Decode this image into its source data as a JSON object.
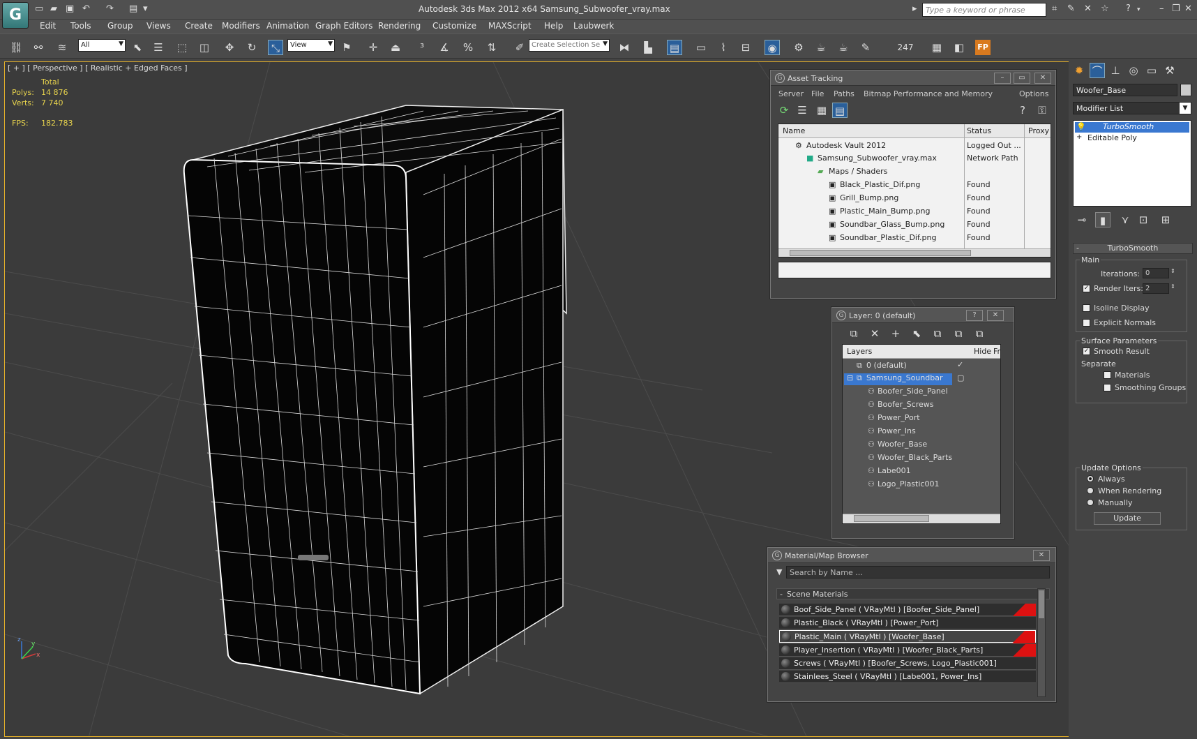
{
  "window": {
    "title": "Autodesk 3ds Max  2012 x64      Samsung_Subwoofer_vray.max",
    "search_placeholder": "Type a keyword or phrase",
    "logo": "3ds-max-logo"
  },
  "menu": [
    "Edit",
    "Tools",
    "Group",
    "Views",
    "Create",
    "Modifiers",
    "Animation",
    "Graph Editors",
    "Rendering",
    "Customize",
    "MAXScript",
    "Help",
    "Laubwerk"
  ],
  "toolbar": {
    "filter_value": "All",
    "refcoord_value": "View",
    "selection_set_placeholder": "Create Selection Se",
    "frame_count": "247"
  },
  "viewport": {
    "label": "[ + ] [ Perspective ] [ Realistic + Edged Faces ]",
    "stats": {
      "total_label": "Total",
      "polys_label": "Polys:",
      "polys_value": "14 876",
      "verts_label": "Verts:",
      "verts_value": "7 740",
      "fps_label": "FPS:",
      "fps_value": "182.783"
    },
    "axis_labels": [
      "z",
      "x",
      "y"
    ]
  },
  "asset_tracking": {
    "title": "Asset Tracking",
    "menu": [
      "Server",
      "File",
      "Paths",
      "Bitmap Performance and Memory",
      "Options"
    ],
    "columns": [
      "Name",
      "Status",
      "Proxy"
    ],
    "rows": [
      {
        "name": "Autodesk Vault 2012",
        "status": "Logged Out ..."
      },
      {
        "name": "Samsung_Subwoofer_vray.max",
        "status": "Network Path"
      },
      {
        "name": "Maps / Shaders",
        "status": ""
      },
      {
        "name": "Black_Plastic_Dif.png",
        "status": "Found"
      },
      {
        "name": "Grill_Bump.png",
        "status": "Found"
      },
      {
        "name": "Plastic_Main_Bump.png",
        "status": "Found"
      },
      {
        "name": "Soundbar_Glass_Bump.png",
        "status": "Found"
      },
      {
        "name": "Soundbar_Plastic_Dif.png",
        "status": "Found"
      }
    ]
  },
  "layer_dialog": {
    "title": "Layer: 0 (default)",
    "columns": [
      "Layers",
      "Hide",
      "Fr"
    ],
    "rows": [
      "0 (default)",
      "Samsung_Soundbar",
      "Boofer_Side_Panel",
      "Boofer_Screws",
      "Power_Port",
      "Power_Ins",
      "Woofer_Base",
      "Woofer_Black_Parts",
      "Labe001",
      "Logo_Plastic001"
    ]
  },
  "material_browser": {
    "title": "Material/Map Browser",
    "search_placeholder": "Search by Name ...",
    "group": "Scene Materials",
    "group_marker": "-",
    "materials": [
      "Boof_Side_Panel  ( VRayMtl )  [Boofer_Side_Panel]",
      "Plastic_Black  ( VRayMtl )  [Power_Port]",
      "Plastic_Main  ( VRayMtl )  [Woofer_Base]",
      "Player_Insertion  ( VRayMtl )  [Woofer_Black_Parts]",
      "Screws  ( VRayMtl )  [Boofer_Screws, Logo_Plastic001]",
      "Stainlees_Steel  ( VRayMtl )  [Labe001, Power_Ins]"
    ]
  },
  "command_panel": {
    "object_name": "Woofer_Base",
    "modifier_list_label": "Modifier List",
    "stack": [
      "TurboSmooth",
      "Editable Poly"
    ],
    "stack_expand": "+",
    "rollout_title": "TurboSmooth",
    "rollout_marker": "-",
    "main_group": "Main",
    "iterations_label": "Iterations:",
    "iterations_value": "0",
    "render_iters_label": "Render Iters:",
    "render_iters_value": "2",
    "isoline_label": "Isoline Display",
    "explicit_normals_label": "Explicit Normals",
    "surface_group": "Surface Parameters",
    "smooth_result_label": "Smooth Result",
    "separate_label": "Separate",
    "materials_label": "Materials",
    "smoothing_groups_label": "Smoothing Groups",
    "update_group": "Update Options",
    "always_label": "Always",
    "when_rendering_label": "When Rendering",
    "manually_label": "Manually",
    "update_button": "Update"
  },
  "colors": {
    "viewport_border": "#e6b12a",
    "stats_text": "#e8d44d",
    "selection_blue": "#3a78d0",
    "material_red": "#dd1111"
  }
}
